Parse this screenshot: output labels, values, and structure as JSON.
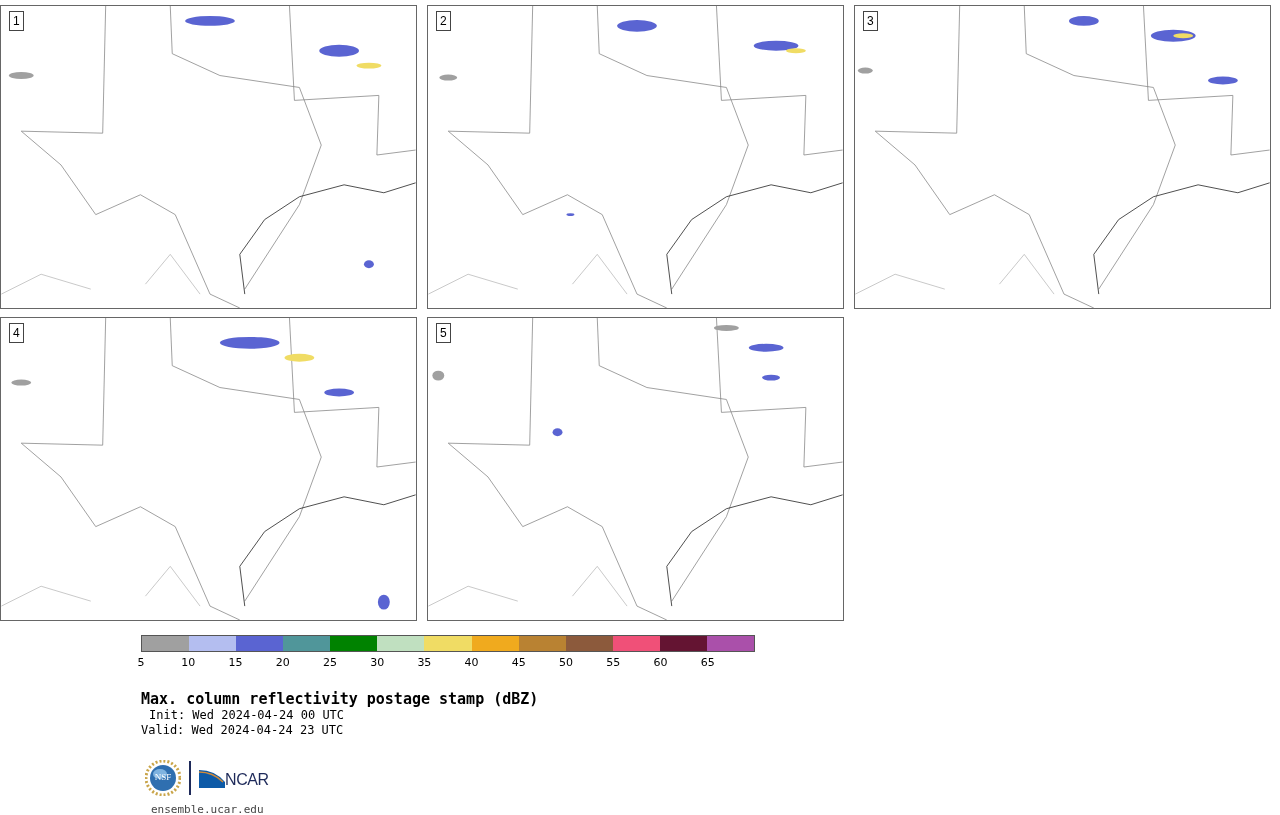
{
  "panels": [
    {
      "label": "1"
    },
    {
      "label": "2"
    },
    {
      "label": "3"
    },
    {
      "label": "4"
    },
    {
      "label": "5"
    }
  ],
  "colorbar": {
    "bins": [
      {
        "label": "5",
        "color": "#a0a0a0"
      },
      {
        "label": "10",
        "color": "#b4bef0"
      },
      {
        "label": "15",
        "color": "#5a64d2"
      },
      {
        "label": "20",
        "color": "#50969a"
      },
      {
        "label": "25",
        "color": "#008200"
      },
      {
        "label": "30",
        "color": "#c0e0c0"
      },
      {
        "label": "35",
        "color": "#f0dc64"
      },
      {
        "label": "40",
        "color": "#f0aa1e"
      },
      {
        "label": "45",
        "color": "#b98232"
      },
      {
        "label": "50",
        "color": "#8c5a3c"
      },
      {
        "label": "55",
        "color": "#f05078"
      },
      {
        "label": "60",
        "color": "#641432"
      },
      {
        "label": "65",
        "color": "#aa50aa"
      }
    ]
  },
  "title": "Max. column reflectivity postage stamp (dBZ)",
  "init": "Init: Wed 2024-04-24 00 UTC",
  "valid": "Valid: Wed 2024-04-24 23 UTC",
  "logos": {
    "nsf": "NSF",
    "ncar": "NCAR"
  },
  "footer": "ensemble.ucar.edu"
}
